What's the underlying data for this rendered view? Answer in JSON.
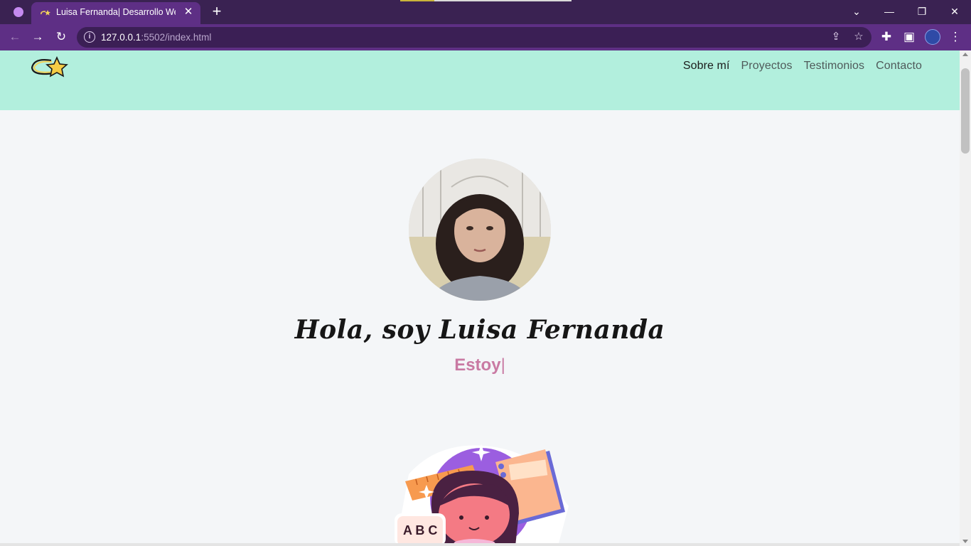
{
  "browser": {
    "tab_title": "Luisa Fernanda| Desarrollo Web",
    "url_host": "127.0.0.1",
    "url_rest": ":5502/index.html",
    "accent_color": "#5e2f85",
    "tabbar_color": "#3a2252"
  },
  "site": {
    "nav": [
      {
        "label": "Sobre mí",
        "active": true
      },
      {
        "label": "Proyectos",
        "active": false
      },
      {
        "label": "Testimonios",
        "active": false
      },
      {
        "label": "Contacto",
        "active": false
      }
    ],
    "greeting": "Hola, soy Luisa Fernanda",
    "typing_text": "Estoy",
    "typing_cursor": "|",
    "header_color": "#b2efdd",
    "typing_color": "#c97aa3",
    "illustration_text": "A B C"
  }
}
